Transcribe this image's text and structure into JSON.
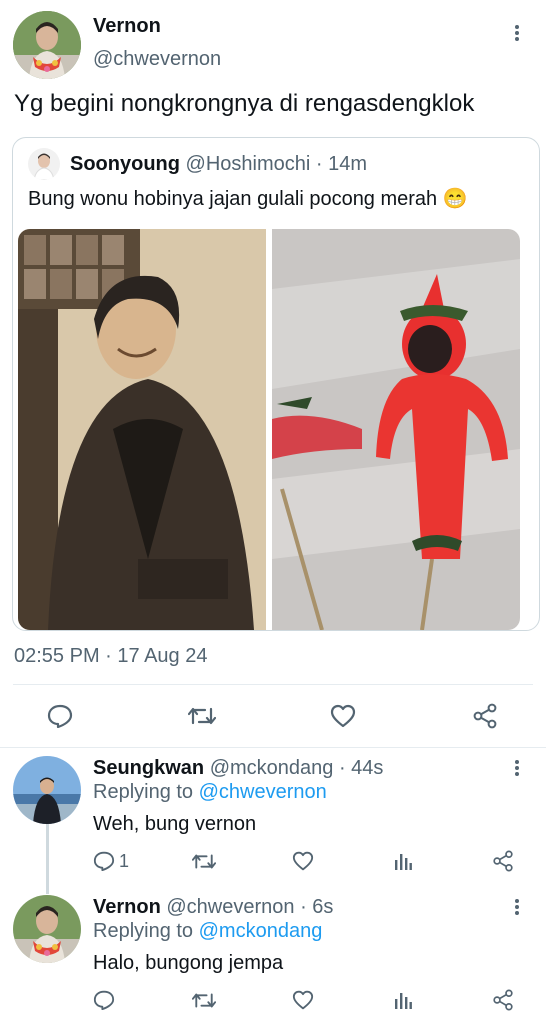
{
  "main_tweet": {
    "author_name": "Vernon",
    "author_handle": "@chwevernon",
    "text": "Yg begini nongkrongnya di rengasdengklok",
    "timestamp": "02:55 PM · 17 Aug 24"
  },
  "quoted_tweet": {
    "author_name": "Soonyoung",
    "author_handle": "@Hoshimochi",
    "time": "· 14m",
    "text": "Bung wonu hobinya jajan gulali pocong merah 😁"
  },
  "replies": [
    {
      "author_name": "Seungkwan",
      "author_handle": "@mckondang",
      "time": "· 44s",
      "replying_prefix": "Replying to",
      "replying_to": "@chwevernon",
      "text": "Weh, bung vernon",
      "reply_count": "1"
    },
    {
      "author_name": "Vernon",
      "author_handle": "@chwevernon",
      "time": "· 6s",
      "replying_prefix": "Replying to",
      "replying_to": "@mckondang",
      "text": "Halo, bungong jempa",
      "reply_count": ""
    }
  ],
  "colors": {
    "accent": "#1d9bf0",
    "secondary_text": "#536471",
    "divider": "#e6ecf0"
  },
  "icons": [
    "more-icon",
    "reply-icon",
    "retweet-icon",
    "like-icon",
    "share-icon",
    "views-icon"
  ]
}
